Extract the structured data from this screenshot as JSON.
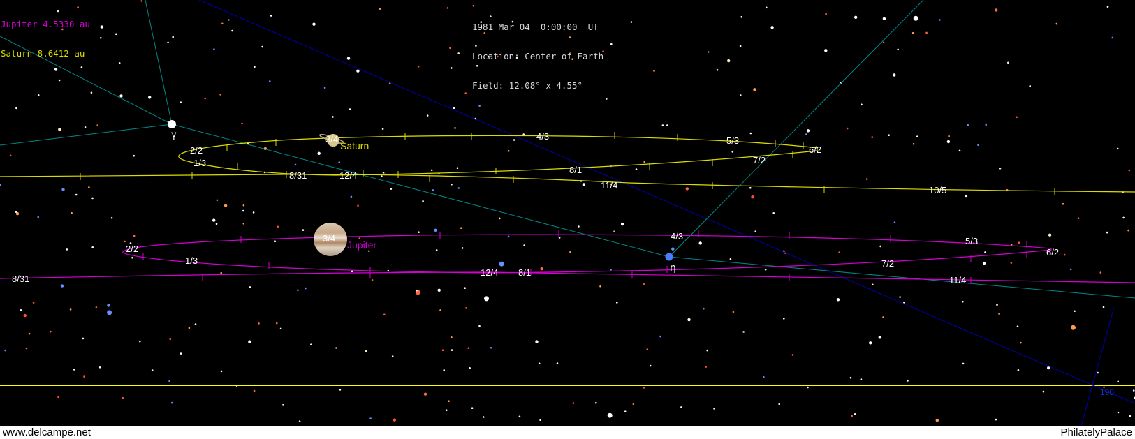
{
  "planet_info": {
    "jupiter": "Jupiter 4.5330 au",
    "saturn": "Saturn 8.6412 au"
  },
  "observation": {
    "date": "1981 Mar 04  0:00:00  UT",
    "location": "Location: Center of Earth",
    "field": "Field: 12.08° x 4.55°"
  },
  "labels": {
    "saturn": "Saturn",
    "jupiter": "Jupiter",
    "gamma": "γ",
    "eta": "η",
    "saturn_dates": [
      "3/4",
      "4/3",
      "5/3",
      "6/2",
      "2/2",
      "1/3",
      "7/2",
      "8/31",
      "12/4",
      "8/1",
      "11/4",
      "10/5"
    ],
    "jupiter_dates": [
      "2/2",
      "3/4",
      "4/3",
      "5/3",
      "6/2",
      "1/3",
      "7/2",
      "12/4",
      "8/1",
      "8/31",
      "11/4"
    ],
    "corner": "190"
  },
  "colors": {
    "jupiter_path": "#d400d4",
    "saturn_path": "#dcdc00",
    "ecliptic": "#ffff00",
    "equator": "#0000b0",
    "grid": "#008888",
    "date_text": "#ffffff"
  },
  "footer": {
    "left": "www.delcampe.net",
    "right": "PhilatelyPalace"
  }
}
